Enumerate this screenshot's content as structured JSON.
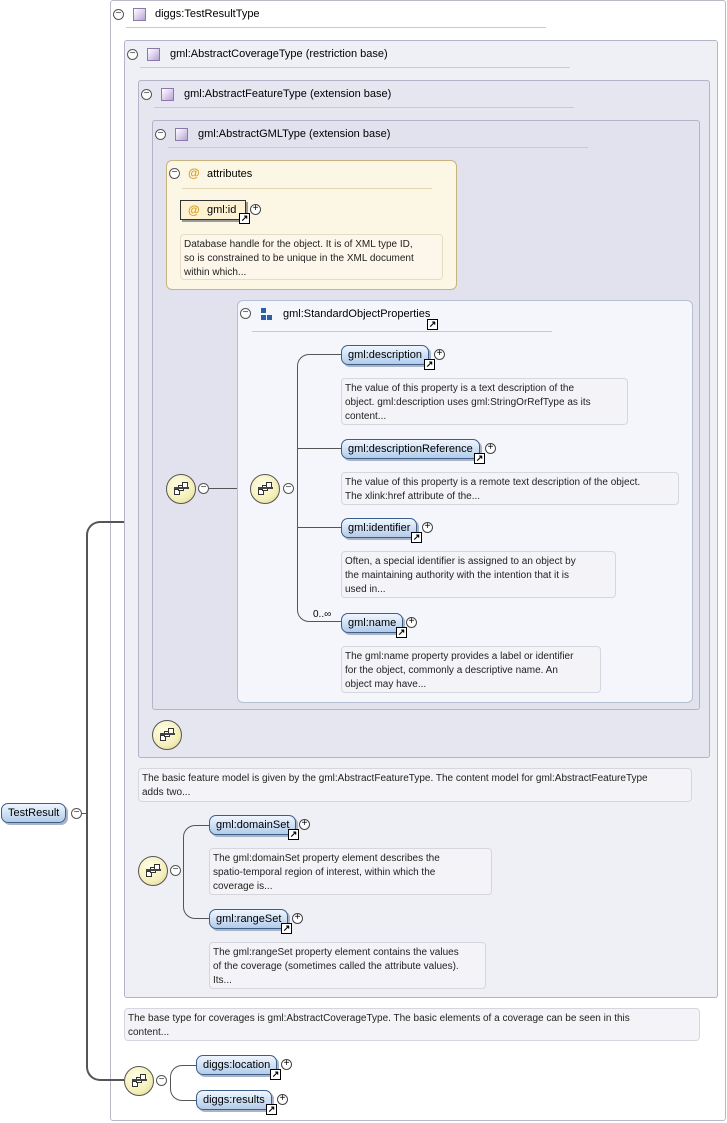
{
  "root": {
    "label": "TestResult"
  },
  "test_result_type": {
    "title": "diggs:TestResultType"
  },
  "coverage_type": {
    "title": "gml:AbstractCoverageType (restriction base)"
  },
  "feature_type": {
    "title": "gml:AbstractFeatureType (extension base)"
  },
  "gml_type": {
    "title": "gml:AbstractGMLType (extension base)"
  },
  "attributes": {
    "title": "attributes",
    "at_symbol": "@",
    "gml_id": {
      "label": "gml:id",
      "doc": [
        "Database handle for the object. It is of XML type ID,",
        "so is constrained to be unique in the XML document",
        "within which..."
      ]
    }
  },
  "standard_props": {
    "title": "gml:StandardObjectProperties",
    "elements": [
      {
        "label": "gml:description",
        "doc": [
          "The value of this property is a text description of the",
          "object. gml:description uses gml:StringOrRefType as its",
          "content..."
        ]
      },
      {
        "label": "gml:descriptionReference",
        "doc": [
          "The value of this property is a remote text description of the object.",
          "The xlink:href attribute of the..."
        ]
      },
      {
        "label": "gml:identifier",
        "doc": [
          "Often, a special identifier is assigned to an object by",
          "the maintaining authority with the intention that it is",
          "used in..."
        ]
      },
      {
        "label": "gml:name",
        "cardinality": "0..∞",
        "doc": [
          "The gml:name property provides a label or identifier",
          "for the object, commonly a descriptive name. An",
          "object may have..."
        ]
      }
    ]
  },
  "feature_doc": [
    "The basic feature model is given by the gml:AbstractFeatureType. The content model for gml:AbstractFeatureType",
    "adds two..."
  ],
  "coverage_elements": [
    {
      "label": "gml:domainSet",
      "doc": [
        "The gml:domainSet property element describes the",
        "spatio-temporal region of interest, within which the",
        "coverage is..."
      ]
    },
    {
      "label": "gml:rangeSet",
      "doc": [
        "The gml:rangeSet property element contains the values",
        "of the coverage (sometimes called the attribute values).",
        "Its..."
      ]
    }
  ],
  "coverage_doc": [
    "The base type for coverages is gml:AbstractCoverageType. The basic elements of a coverage can be seen in this",
    "content..."
  ],
  "diggs_elements": [
    {
      "label": "diggs:location"
    },
    {
      "label": "diggs:results"
    }
  ],
  "symbols": {
    "collapse": "−",
    "expand": "+",
    "ref_arrow": "↗"
  },
  "icons": {
    "type_icon": "complex-type-icon",
    "group_icon": "group-icon",
    "sequence_icon": "sequence-compositor-icon",
    "attribute_icon": "attribute-at-icon",
    "ref_icon": "reference-arrow-icon"
  },
  "colors": {
    "element_fill": "#cddff4",
    "element_border": "#3b5f8a",
    "attributes_fill": "#fcf6e4",
    "attributes_border": "#c7b37e",
    "type_box_fill": "#ececf5",
    "group_box_fill": "#f4f6fb",
    "compositor_fill": "#f4efb9"
  }
}
